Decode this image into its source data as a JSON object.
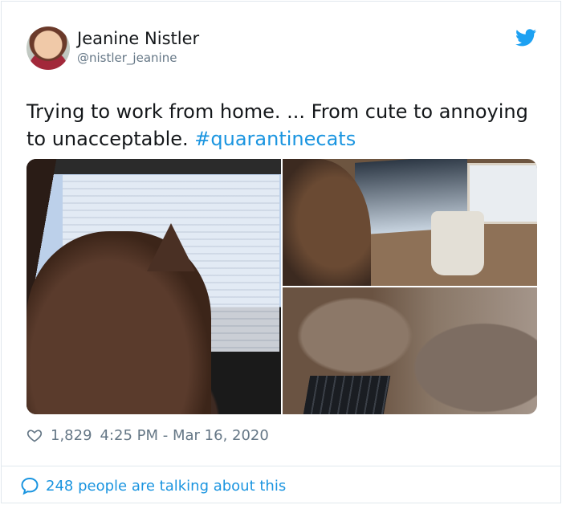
{
  "author": {
    "name": "Jeanine Nistler",
    "handle": "@nistler_jeanine"
  },
  "tweet": {
    "text": "Trying to work from home. ... From cute to annoying to unacceptable.",
    "hashtag": "#quarantinecats"
  },
  "stats": {
    "likes": "1,829",
    "timestamp": "4:25 PM - Mar 16, 2020"
  },
  "conversation": {
    "label": "248 people are talking about this"
  },
  "icons": {
    "brand": "twitter-bird-icon",
    "like": "heart-outline-icon",
    "reply": "speech-bubble-icon"
  },
  "colors": {
    "brand": "#1da1f2",
    "link": "#1b95e0",
    "secondary_text": "#657786",
    "primary_text": "#14171a",
    "border": "#e1e8ed"
  }
}
